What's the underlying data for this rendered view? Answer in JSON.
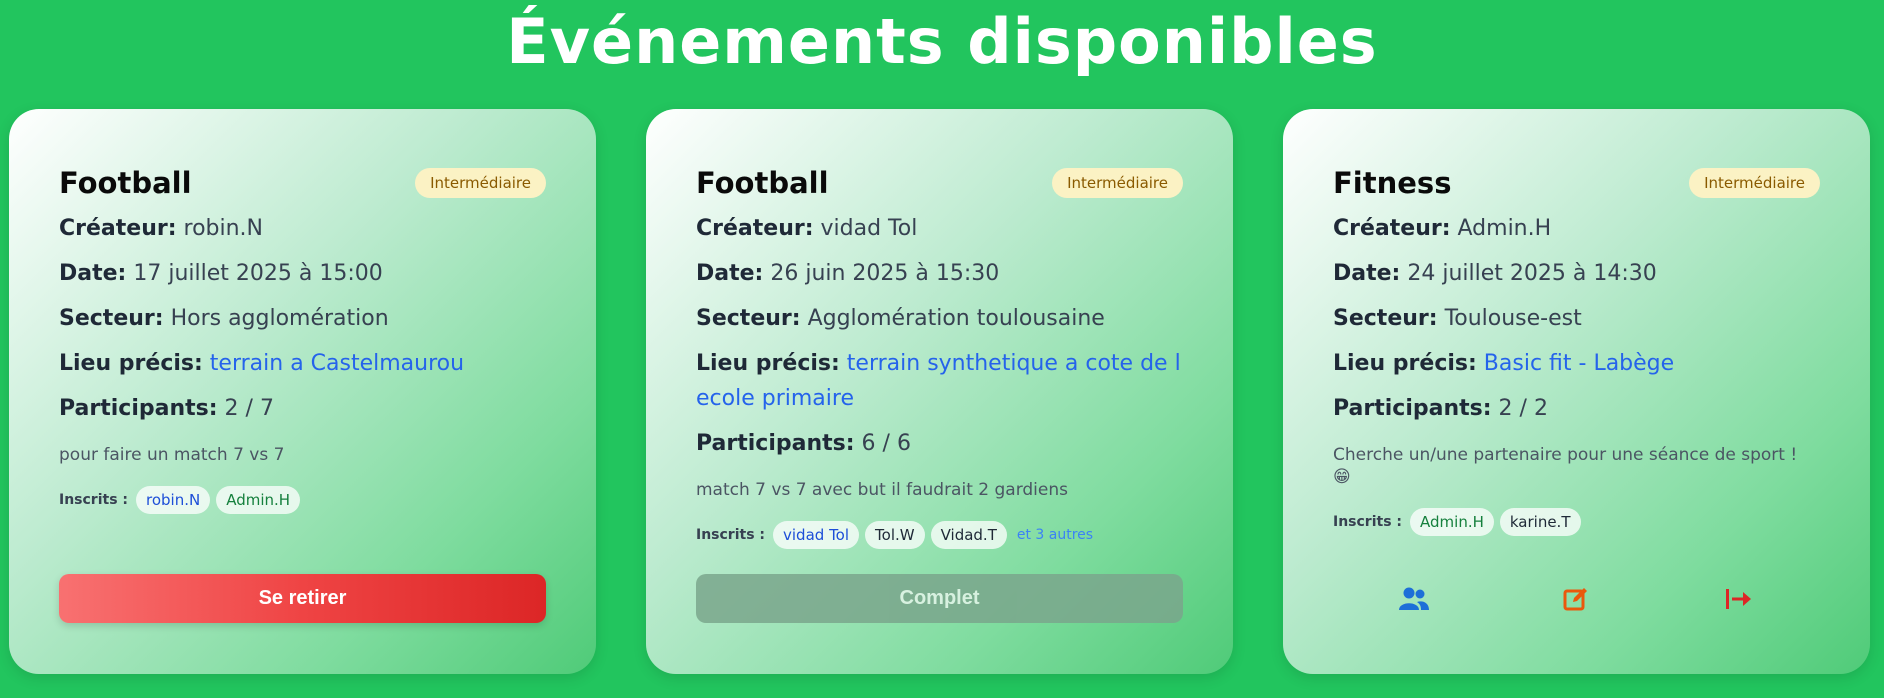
{
  "page": {
    "title": "Événements disponibles"
  },
  "labels": {
    "creator": "Créateur:",
    "date": "Date:",
    "sector": "Secteur:",
    "place": "Lieu précis:",
    "participants": "Participants:",
    "registered": "Inscrits :"
  },
  "cards": [
    {
      "sport": "Football",
      "level": "Intermédiaire",
      "creator": "robin.N",
      "date": "17 juillet 2025 à 15:00",
      "sector": "Hors agglomération",
      "place": "terrain a Castelmaurou",
      "participants": "2 / 7",
      "description": "pour faire un match 7 vs 7",
      "registered": [
        "robin.N",
        "Admin.H"
      ],
      "action": "Se retirer"
    },
    {
      "sport": "Football",
      "level": "Intermédiaire",
      "creator": "vidad Tol",
      "date": "26 juin 2025 à 15:30",
      "sector": "Agglomération toulousaine",
      "place": "terrain synthetique a cote de l ecole primaire",
      "participants": "6 / 6",
      "description": "match 7 vs 7 avec but il faudrait 2 gardiens",
      "registered": [
        "vidad Tol",
        "Tol.W",
        "Vidad.T"
      ],
      "more": "et 3 autres",
      "action": "Complet"
    },
    {
      "sport": "Fitness",
      "level": "Intermédiaire",
      "creator": "Admin.H",
      "date": "24 juillet 2025 à 14:30",
      "sector": "Toulouse-est",
      "place": "Basic fit - Labège",
      "participants": "2 / 2",
      "description": "Cherche un/une partenaire pour une séance de sport ! 😁",
      "registered": [
        "Admin.H",
        "karine.T"
      ],
      "icons": [
        "participants-icon",
        "edit-icon",
        "leave-icon"
      ]
    }
  ],
  "colors": {
    "background": "#22c55e",
    "link": "#2563eb",
    "danger": "#dc2626",
    "edit": "#ea580c"
  }
}
